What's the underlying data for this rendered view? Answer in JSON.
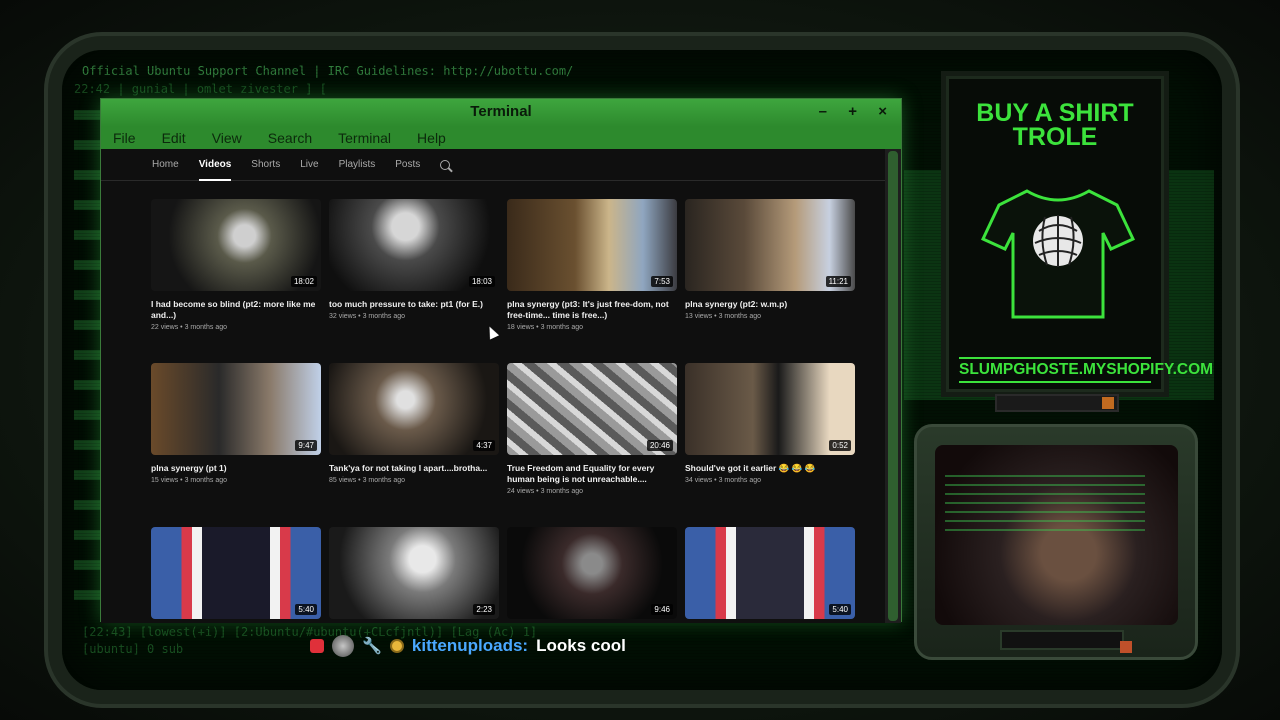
{
  "background": {
    "topic_line": "Official Ubuntu Support Channel | IRC Guidelines: http://ubottu.com/",
    "nicks_line": "22:42 | gunial            |  omlet           zivester         ]           [",
    "status_line": "[22:43] [lowest(+i)] [2:Ubuntu/#ubuntu(+CLcfjntl)] [Lag (Ac) 1]",
    "tab_line": "[ubuntu]  0 sub"
  },
  "terminal": {
    "title": "Terminal",
    "controls": {
      "minimize": "–",
      "maximize": "+",
      "close": "×"
    },
    "menu": [
      "File",
      "Edit",
      "View",
      "Search",
      "Terminal",
      "Help"
    ]
  },
  "channel": {
    "tabs": [
      "Home",
      "Videos",
      "Shorts",
      "Live",
      "Playlists",
      "Posts"
    ],
    "active_tab": "Videos",
    "videos": [
      {
        "title": "I had become so blind (pt2: more like me and...)",
        "meta": "22 views • 3 months ago",
        "duration": "18:02"
      },
      {
        "title": "too much pressure to take: pt1 (for E.)",
        "meta": "32 views • 3 months ago",
        "duration": "18:03"
      },
      {
        "title": "plna synergy (pt3: It's just free-dom, not free-time... time is free...)",
        "meta": "18 views • 3 months ago",
        "duration": "7:53"
      },
      {
        "title": "plna synergy (pt2: w.m.p)",
        "meta": "13 views • 3 months ago",
        "duration": "11:21"
      },
      {
        "title": "plna synergy (pt 1)",
        "meta": "15 views • 3 months ago",
        "duration": "9:47"
      },
      {
        "title": "Tank'ya for not taking I apart....brotha...",
        "meta": "85 views • 3 months ago",
        "duration": "4:37"
      },
      {
        "title": "True Freedom and Equality for every human being is not unreachable....",
        "meta": "24 views • 3 months ago",
        "duration": "20:46"
      },
      {
        "title": "Should've got it earlier 😂 😂 😂",
        "meta": "34 views • 3 months ago",
        "duration": "0:52"
      },
      {
        "title": "",
        "meta": "",
        "duration": "5:40"
      },
      {
        "title": "",
        "meta": "",
        "duration": "2:23"
      },
      {
        "title": "",
        "meta": "",
        "duration": "9:46"
      },
      {
        "title": "",
        "meta": "",
        "duration": "5:40"
      }
    ]
  },
  "ad": {
    "title_line1": "BUY A SHIRT",
    "title_line2": "TROLE",
    "url": "SLUMPGHOSTE.MYSHOPIFY.COM",
    "accent": "#3ce33c"
  },
  "chat": {
    "user": "kittenuploads:",
    "message": "Looks cool",
    "user_color": "#4aa8ff"
  },
  "icons": {
    "search": "search-icon",
    "shirt": "shirt-icon",
    "cursor": "mouse-cursor"
  }
}
